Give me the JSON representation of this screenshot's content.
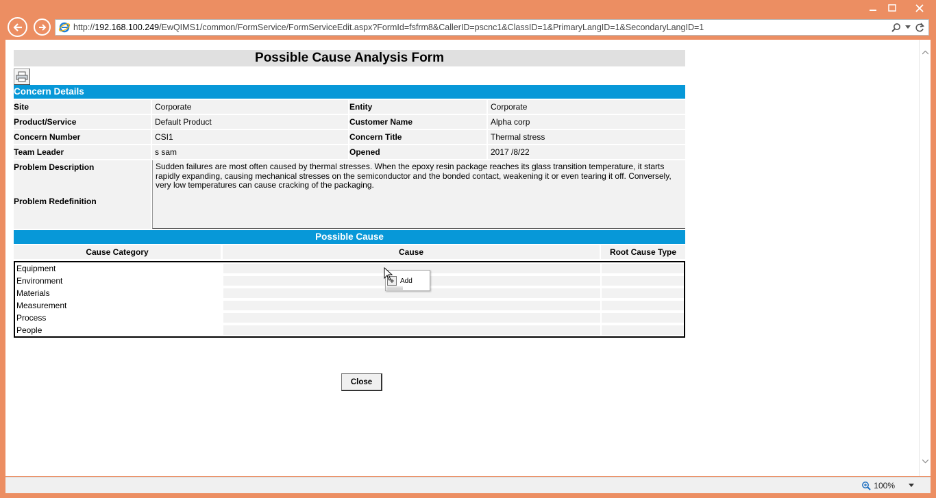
{
  "browser": {
    "url_prefix": "http://",
    "url_host": "192.168.100.249",
    "url_path": "/EwQIMS1/common/FormService/FormServiceEdit.aspx?FormId=fsfrm8&CallerID=pscnc1&ClassID=1&PrimaryLangID=1&SecondaryLangID=1",
    "zoom": "100%"
  },
  "form": {
    "title": "Possible Cause Analysis Form",
    "concern_section": "Concern Details",
    "details": [
      {
        "label1": "Site",
        "value1": "Corporate",
        "label2": "Entity",
        "value2": "Corporate"
      },
      {
        "label1": "Product/Service",
        "value1": "Default Product",
        "label2": "Customer Name",
        "value2": "Alpha corp"
      },
      {
        "label1": "Concern Number",
        "value1": "CSI1",
        "label2": "Concern Title",
        "value2": "Thermal stress"
      },
      {
        "label1": "Team Leader",
        "value1": "s sam",
        "label2": "Opened",
        "value2": "2017 /8/22"
      }
    ],
    "problem_description_label": "Problem Description",
    "problem_redefinition_label": "Problem Redefinition",
    "problem_description": "Sudden failures are most often caused by thermal stresses. When the epoxy resin package reaches its glass transition temperature, it starts rapidly expanding, causing mechanical stresses on the semiconductor and the bonded contact, weakening it or even tearing it off. Conversely, very low temperatures can cause cracking of the packaging.",
    "possible_cause_section": "Possible Cause",
    "columns": [
      "Cause Category",
      "Cause",
      "Root Cause Type"
    ],
    "categories": [
      "Equipment",
      "Environment",
      "Materials",
      "Measurement",
      "Process",
      "People"
    ],
    "close_label": "Close",
    "context_menu": {
      "add_label": "Add"
    }
  },
  "colors": {
    "window_frame": "#ec8e62",
    "section_bar": "#0798d8",
    "row_background": "#f2f2f2"
  }
}
